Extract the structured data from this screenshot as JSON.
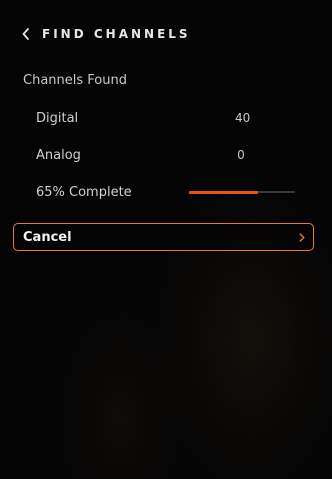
{
  "header": {
    "back_icon": "chevron-left-icon",
    "title": "FIND CHANNELS"
  },
  "channels": {
    "section_label": "Channels Found",
    "digital_label": "Digital",
    "digital_count": "40",
    "analog_label": "Analog",
    "analog_count": "0"
  },
  "progress": {
    "label": "65% Complete",
    "percent": 65
  },
  "cancel": {
    "label": "Cancel",
    "icon": "chevron-right-icon"
  },
  "colors": {
    "background": "#050505",
    "accent": "#f07a1a",
    "progress_fill": "#e8521c",
    "progress_track": "#3a3a3a"
  }
}
